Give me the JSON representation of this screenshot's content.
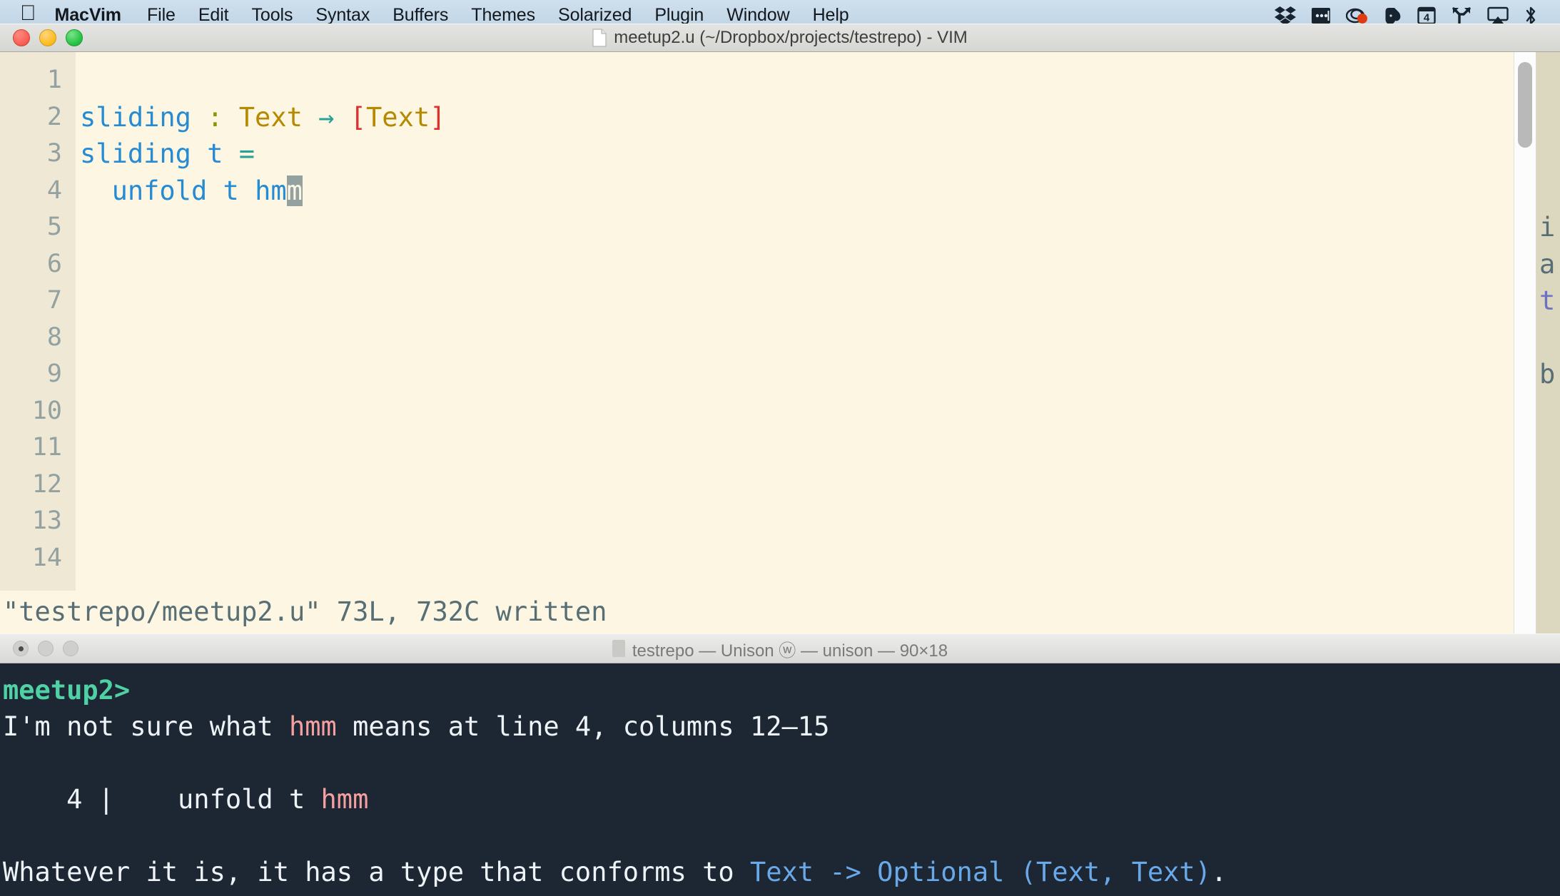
{
  "menubar": {
    "apple_glyph": "&#63743;",
    "items": [
      {
        "label": "MacVim",
        "bold": true
      },
      {
        "label": "File",
        "bold": false
      },
      {
        "label": "Edit",
        "bold": false
      },
      {
        "label": "Tools",
        "bold": false
      },
      {
        "label": "Syntax",
        "bold": false
      },
      {
        "label": "Buffers",
        "bold": false
      },
      {
        "label": "Themes",
        "bold": false
      },
      {
        "label": "Solarized",
        "bold": false
      },
      {
        "label": "Plugin",
        "bold": false
      },
      {
        "label": "Window",
        "bold": false
      },
      {
        "label": "Help",
        "bold": false
      }
    ],
    "tray_icons": [
      "dropbox-icon",
      "dots-box-icon",
      "screen-record-icon",
      "evernote-icon",
      "calendar-4-icon",
      "fork-branch-icon",
      "airplay-icon",
      "bluetooth-icon"
    ],
    "calendar_day": "4"
  },
  "vim": {
    "title": "meetup2.u (~/Dropbox/projects/testrepo) - VIM",
    "window_buttons": [
      "close-button",
      "minimize-button",
      "zoom-button"
    ],
    "line_numbers": [
      "1",
      "2",
      "3",
      "4",
      "5",
      "6",
      "7",
      "8",
      "9",
      "10",
      "11",
      "12",
      "13",
      "14"
    ],
    "code": {
      "line2": {
        "fn": "sliding",
        "colon": ":",
        "type1": "Text",
        "arrow": "→",
        "bracket_open": "[",
        "type2": "Text",
        "bracket_close": "]"
      },
      "line3": {
        "fn": "sliding",
        "arg": "t",
        "eq": "="
      },
      "line4": {
        "indent": "  ",
        "fn": "unfold",
        "arg": "t",
        "term_pre": "hm",
        "term_cursor": "m"
      }
    },
    "status_line": "\"testrepo/meetup2.u\" 73L, 732C written",
    "right_pane_lines": [
      "i",
      "a",
      "t",
      "",
      "b"
    ]
  },
  "terminal": {
    "title": "testrepo — Unison ⓦ — unison — 90×18",
    "window_buttons": [
      "close-button",
      "minimize-button",
      "zoom-button"
    ],
    "prompt": "meetup2>",
    "error_pre": "I'm not sure what ",
    "error_token": "hmm",
    "error_post": " means at line 4, columns 12–15",
    "snippet_prefix": "    4 |    unfold t ",
    "snippet_token": "hmm",
    "conform_pre": "Whatever it is, it has a type that conforms to ",
    "conform_type": "Text -> Optional (Text, Text)",
    "conform_post": "."
  },
  "colors": {
    "editor_bg": "#fdf6e3",
    "gutter_bg": "#eee8d5",
    "line_number": "#93a1a1",
    "fn_blue": "#268bd2",
    "type_amber": "#b58900",
    "arrow_teal": "#2aa198",
    "bracket_red": "#dc322f",
    "colon_green": "#859900",
    "cursor_gray": "#93a1a1",
    "terminal_bg": "#1d2733",
    "terminal_fg": "#eef3f7",
    "prompt_green": "#4fd1a5",
    "error_salmon": "#f4a0a0",
    "type_lightblue": "#6aa9e9",
    "menubar_bg": "#c6d9e9"
  }
}
